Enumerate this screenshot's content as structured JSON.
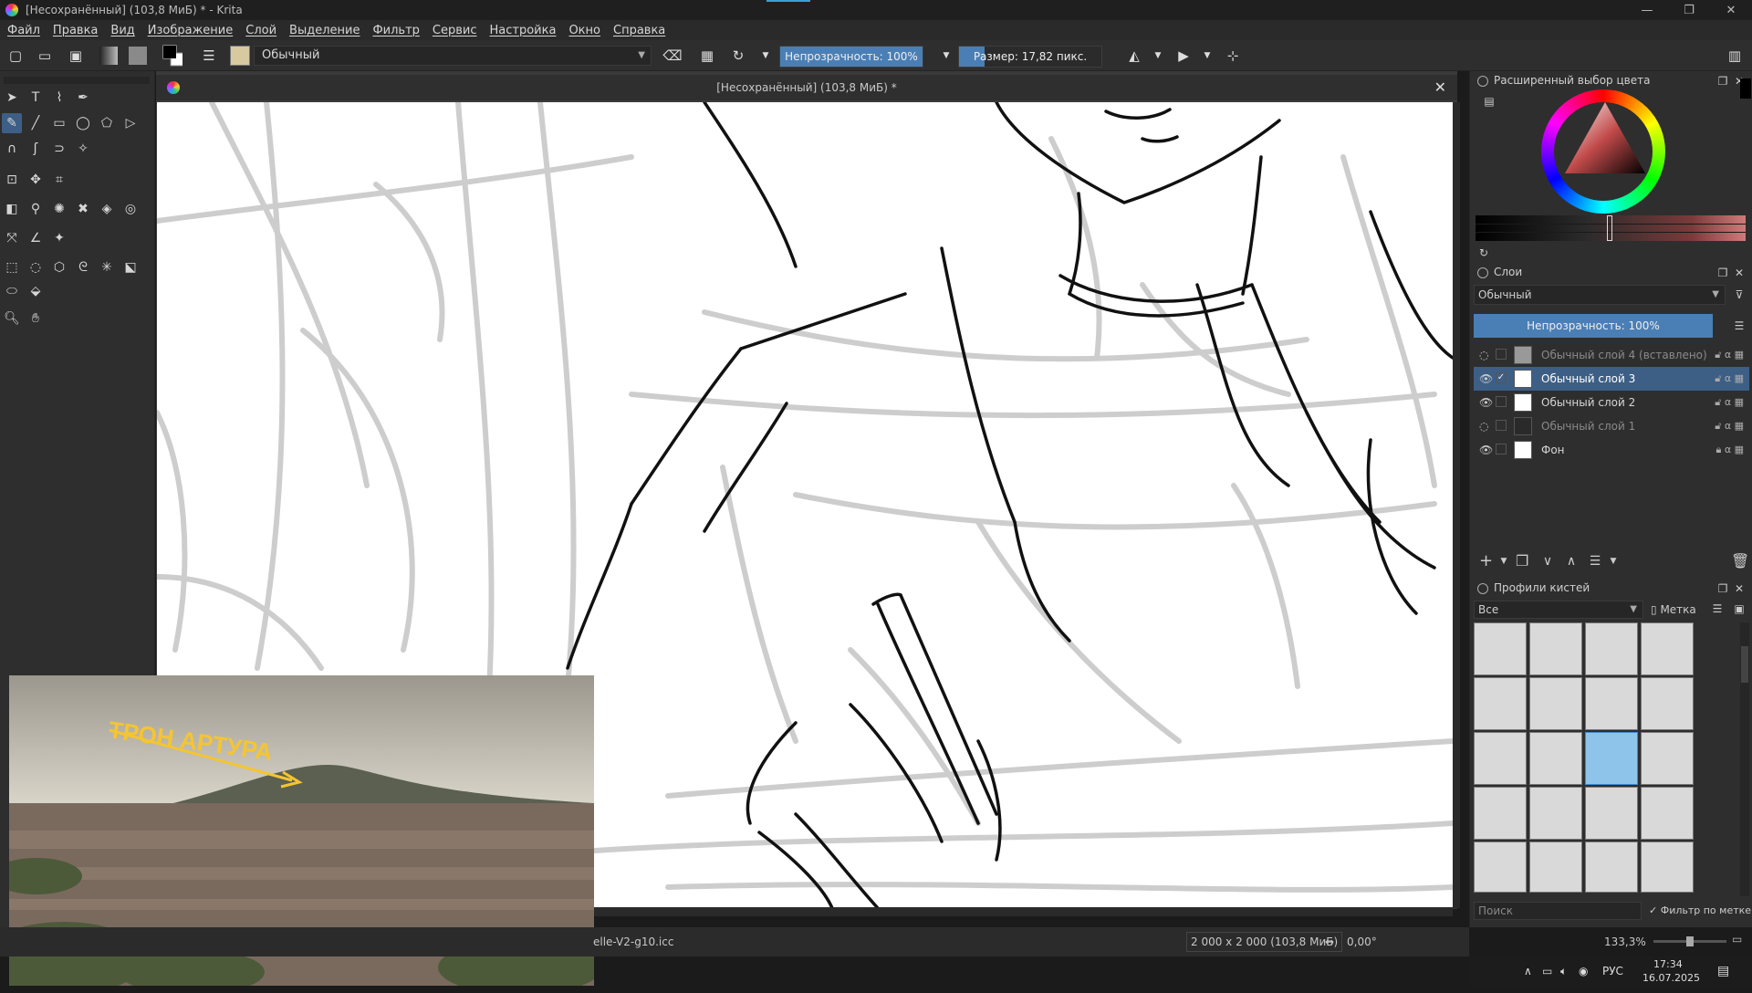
{
  "window": {
    "title": "[Несохранённый]  (103,8 МиБ) * - Krita",
    "minimize": "—",
    "maximize": "❐",
    "close": "✕"
  },
  "menu": [
    "Файл",
    "Правка",
    "Вид",
    "Изображение",
    "Слой",
    "Выделение",
    "Фильтр",
    "Сервис",
    "Настройка",
    "Окно",
    "Справка"
  ],
  "toolbar": {
    "brush_preset": "Обычный",
    "opacity_label": "Непрозрачность: 100%",
    "opacity_value": 100,
    "size_label": "Размер: 17,82 пикс.",
    "size_fill_fraction": 0.18
  },
  "document": {
    "tab_title": "[Несохранённый]  (103,8 МиБ) *",
    "close": "✕"
  },
  "status": {
    "profile": "elle-V2-g10.icc",
    "dimensions": "2 000 x 2 000 (103,8 МиБ)",
    "rotation": "0,00°",
    "zoom": "133,3%"
  },
  "reference_image": {
    "caption": "ТРОН АРТУРА"
  },
  "color_panel": {
    "title": "Расширенный выбор цвета"
  },
  "layers_panel": {
    "title": "Слои",
    "blend_mode": "Обычный",
    "opacity_label": "Непрозрачность:  100%",
    "layers": [
      {
        "name": "Обычный слой 4 (вставлено)",
        "visible": false,
        "selected": false
      },
      {
        "name": "Обычный слой 3",
        "visible": true,
        "selected": true
      },
      {
        "name": "Обычный слой 2",
        "visible": true,
        "selected": false
      },
      {
        "name": "Обычный слой 1",
        "visible": false,
        "selected": false
      },
      {
        "name": "Фон",
        "visible": true,
        "selected": false
      }
    ]
  },
  "brushes_panel": {
    "title": "Профили кистей",
    "filter": "Все",
    "tag_label": "Метка",
    "search_placeholder": "Поиск",
    "filter_by_tag": "Фильтр по метке"
  },
  "taskbar": {
    "lang": "РУС",
    "time": "17:34",
    "date": "16.07.2025"
  },
  "colors": {
    "accent": "#3d5f86",
    "slider_fill": "#4a7fb5"
  }
}
